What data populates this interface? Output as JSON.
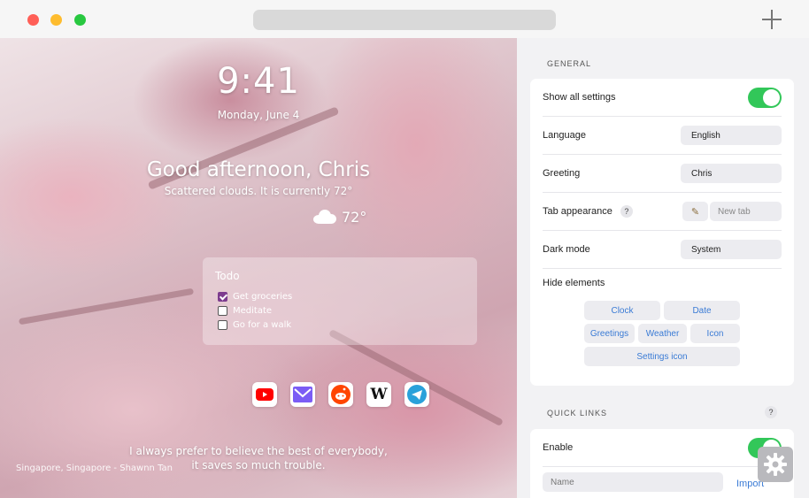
{
  "window": {
    "buttons": [
      "close",
      "minimize",
      "zoom"
    ],
    "new_tab_icon": "plus-icon"
  },
  "preview": {
    "time": "9:41",
    "date": "Monday, June 4",
    "greeting": "Good afternoon, Chris",
    "weather_summary": "Scattered clouds. It is currently 72°",
    "weather_icon": "cloud-icon",
    "temperature": "72°",
    "todo": {
      "title": "Todo",
      "items": [
        {
          "label": "Get groceries",
          "checked": true
        },
        {
          "label": "Meditate",
          "checked": false
        },
        {
          "label": "Go for a walk",
          "checked": false
        }
      ]
    },
    "quick_links": [
      "youtube-icon",
      "mail-icon",
      "reddit-icon",
      "wikipedia-icon",
      "telegram-icon"
    ],
    "quote_line1": "I always prefer to believe the best of everybody,",
    "quote_line2": "it saves so much trouble.",
    "photo_credit": "Singapore, Singapore - Shawnn Tan"
  },
  "settings": {
    "general_title": "GENERAL",
    "show_all_label": "Show all settings",
    "show_all_on": true,
    "language_label": "Language",
    "language_value": "English",
    "greeting_label": "Greeting",
    "greeting_value": "Chris",
    "tab_appearance_label": "Tab appearance",
    "tab_appearance_help": "?",
    "tab_title_placeholder": "New tab",
    "dark_mode_label": "Dark mode",
    "dark_mode_value": "System",
    "hide_elements_label": "Hide elements",
    "hide_chips": [
      "Clock",
      "Date",
      "Greetings",
      "Weather",
      "Icon",
      "Settings icon"
    ],
    "quick_links_title": "QUICK LINKS",
    "quick_links_help": "?",
    "enable_label": "Enable",
    "enable_on": true,
    "name_placeholder": "Name",
    "import_label": "Import"
  },
  "colors": {
    "toggle_on": "#32c759",
    "accent_link": "#3a7bd5",
    "todo_check": "#7d3c8e"
  }
}
